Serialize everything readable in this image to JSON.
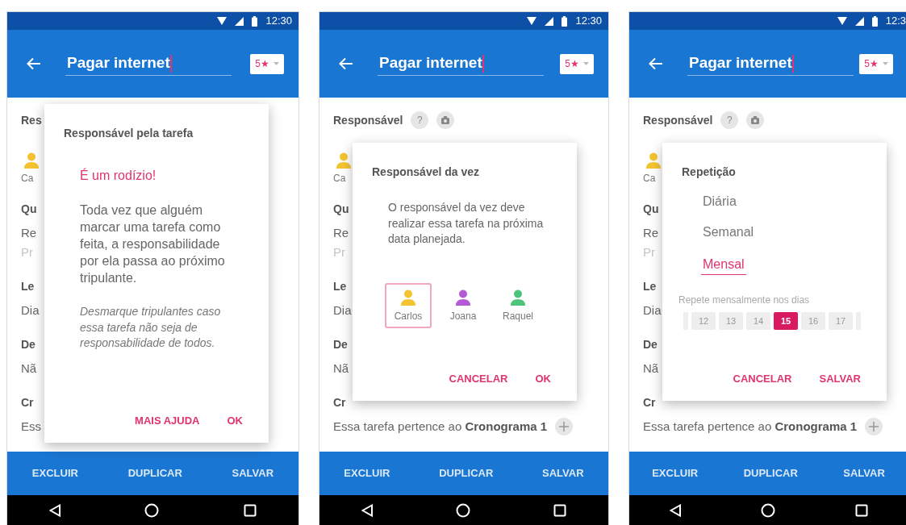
{
  "phones": [
    {
      "status_time": "12:30",
      "app_bar": {
        "title": "Pagar internet",
        "rating": "5★"
      },
      "background": [
        {
          "kind": "heading",
          "text": "Res"
        },
        {
          "kind": "person",
          "text": "Ca",
          "color": "#f4c430"
        },
        {
          "kind": "heading",
          "text": "Qu"
        },
        {
          "kind": "text",
          "text": "Re"
        },
        {
          "kind": "muted",
          "text": "Pr"
        },
        {
          "kind": "heading",
          "text": "Le"
        },
        {
          "kind": "text",
          "text": "Dia"
        },
        {
          "kind": "heading",
          "text": "De"
        },
        {
          "kind": "text",
          "text": "Nã"
        },
        {
          "kind": "heading",
          "text": "Cr"
        },
        {
          "kind": "text",
          "text": "Ess"
        }
      ],
      "dialog": {
        "kind": "info",
        "title": "Responsável pela tarefa",
        "highlight": "É um rodízio!",
        "body": "Toda vez que alguém marcar uma tarefa como feita, a responsabilidade por ela passa ao próximo tripulante.",
        "note": "Desmarque tripulantes caso essa tarefa não seja de responsabilidade de todos.",
        "actions": [
          "MAIS AJUDA",
          "OK"
        ]
      },
      "bottom_bar": [
        "EXCLUIR",
        "DUPLICAR",
        "SALVAR"
      ]
    },
    {
      "status_time": "12:30",
      "app_bar": {
        "title": "Pagar internet",
        "rating": "5★"
      },
      "background": [
        {
          "kind": "heading_icons",
          "text": "Responsável",
          "help": "?"
        },
        {
          "kind": "person",
          "text": "Ca",
          "color": "#f4c430"
        },
        {
          "kind": "heading",
          "text": "Qu"
        },
        {
          "kind": "text",
          "text": "Re"
        },
        {
          "kind": "muted",
          "text": "Pr"
        },
        {
          "kind": "heading",
          "text": "Le"
        },
        {
          "kind": "text",
          "text": "Dia"
        },
        {
          "kind": "heading",
          "text": "De"
        },
        {
          "kind": "text",
          "text": "Nã"
        },
        {
          "kind": "heading",
          "text": "Cr"
        },
        {
          "kind": "schedule",
          "text": "Essa tarefa pertence ao **Cronograma 1**"
        }
      ],
      "dialog": {
        "kind": "picker",
        "title": "Responsável da vez",
        "body": "O responsável da vez deve realizar essa tarefa na próxima data planejada.",
        "people": [
          {
            "name": "Carlos",
            "color": "#f4c430",
            "selected": true
          },
          {
            "name": "Joana",
            "color": "#b45ad6",
            "selected": false
          },
          {
            "name": "Raquel",
            "color": "#4cc47a",
            "selected": false
          }
        ],
        "actions": [
          "CANCELAR",
          "OK"
        ]
      },
      "bottom_bar": [
        "EXCLUIR",
        "DUPLICAR",
        "SALVAR"
      ]
    },
    {
      "status_time": "12:3",
      "app_bar": {
        "title": "Pagar internet",
        "rating": "5★"
      },
      "background": [
        {
          "kind": "heading_icons",
          "text": "Responsável",
          "help": "?"
        },
        {
          "kind": "person",
          "text": "Ca",
          "color": "#f4c430"
        },
        {
          "kind": "heading",
          "text": "Qu"
        },
        {
          "kind": "text",
          "text": "Re"
        },
        {
          "kind": "muted",
          "text": "Pr"
        },
        {
          "kind": "heading",
          "text": "Le"
        },
        {
          "kind": "text",
          "text": "Dia"
        },
        {
          "kind": "heading",
          "text": "De"
        },
        {
          "kind": "text",
          "text": "Nã"
        },
        {
          "kind": "heading",
          "text": "Cr"
        },
        {
          "kind": "schedule",
          "text": "Essa tarefa pertence ao **Cronograma 1**"
        }
      ],
      "dialog": {
        "kind": "repeat",
        "title": "Repetição",
        "options": [
          {
            "label": "Diária",
            "selected": false
          },
          {
            "label": "Semanal",
            "selected": false
          },
          {
            "label": "Mensal",
            "selected": true
          }
        ],
        "days_label": "Repete mensalmente nos dias",
        "days": [
          {
            "label": "12",
            "selected": false
          },
          {
            "label": "13",
            "selected": false
          },
          {
            "label": "14",
            "selected": false
          },
          {
            "label": "15",
            "selected": true
          },
          {
            "label": "16",
            "selected": false
          },
          {
            "label": "17",
            "selected": false
          }
        ],
        "actions": [
          "CANCELAR",
          "SALVAR"
        ]
      },
      "bottom_bar": [
        "EXCLUIR",
        "DUPLICAR",
        "SALVAR"
      ]
    }
  ]
}
